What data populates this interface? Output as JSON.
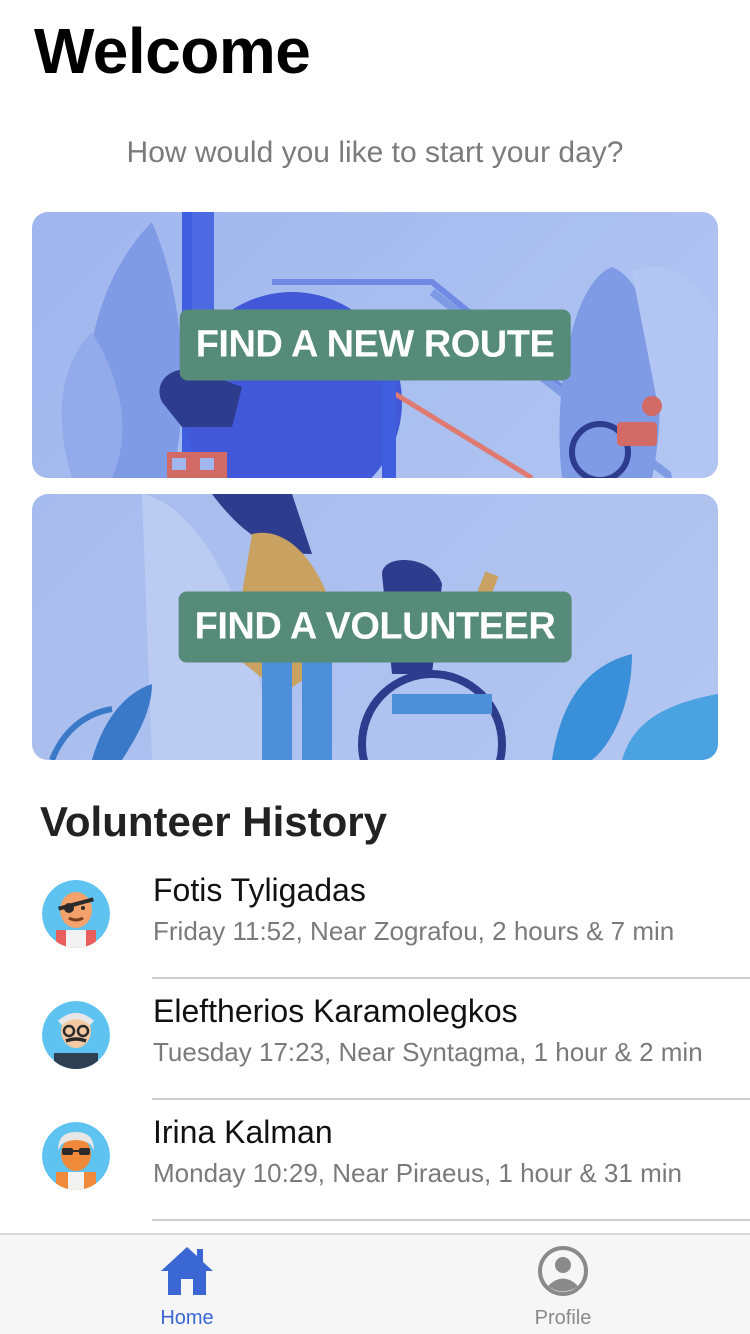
{
  "header": {
    "title": "Welcome",
    "subtitle": "How would you like to start your day?"
  },
  "cards": {
    "route_label": "FIND A NEW ROUTE",
    "volunteer_label": "FIND A VOLUNTEER"
  },
  "history": {
    "title": "Volunteer History",
    "items": [
      {
        "name": "Fotis Tyligadas",
        "detail": "Friday 11:52, Near Zografou, 2 hours & 7 min",
        "avatar": "avatar-eyepatch-icon"
      },
      {
        "name": "Eleftherios Karamolegkos",
        "detail": "Tuesday 17:23, Near Syntagma, 1 hour & 2 min",
        "avatar": "avatar-glasses-mustache-icon"
      },
      {
        "name": "Irina Kalman",
        "detail": "Monday 10:29, Near Piraeus, 1 hour & 31 min",
        "avatar": "avatar-sunglasses-icon"
      }
    ]
  },
  "tabs": {
    "home_label": "Home",
    "profile_label": "Profile"
  },
  "colors": {
    "accent": "#3a67d4",
    "card_button": "#558b78",
    "card_bg": "#a9bff0"
  }
}
